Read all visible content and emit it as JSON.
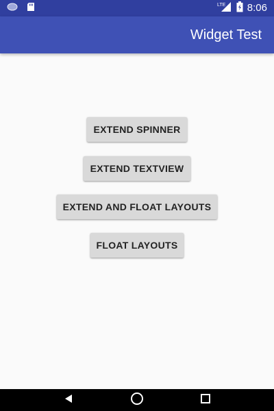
{
  "status_bar": {
    "time": "8:06",
    "network_label": "LTE",
    "icons": [
      "notification-icon",
      "sd-card-icon",
      "signal-icon",
      "battery-icon"
    ]
  },
  "app_bar": {
    "title": "Widget Test",
    "color": "#3f51b5",
    "status_color": "#303f9f"
  },
  "buttons": [
    {
      "label": "EXTEND SPINNER"
    },
    {
      "label": "EXTEND TEXTVIEW"
    },
    {
      "label": "EXTEND AND FLOAT LAYOUTS"
    },
    {
      "label": "FLOAT LAYOUTS"
    }
  ],
  "nav_bar": {
    "icons": [
      "back-icon",
      "home-icon",
      "recents-icon"
    ]
  }
}
